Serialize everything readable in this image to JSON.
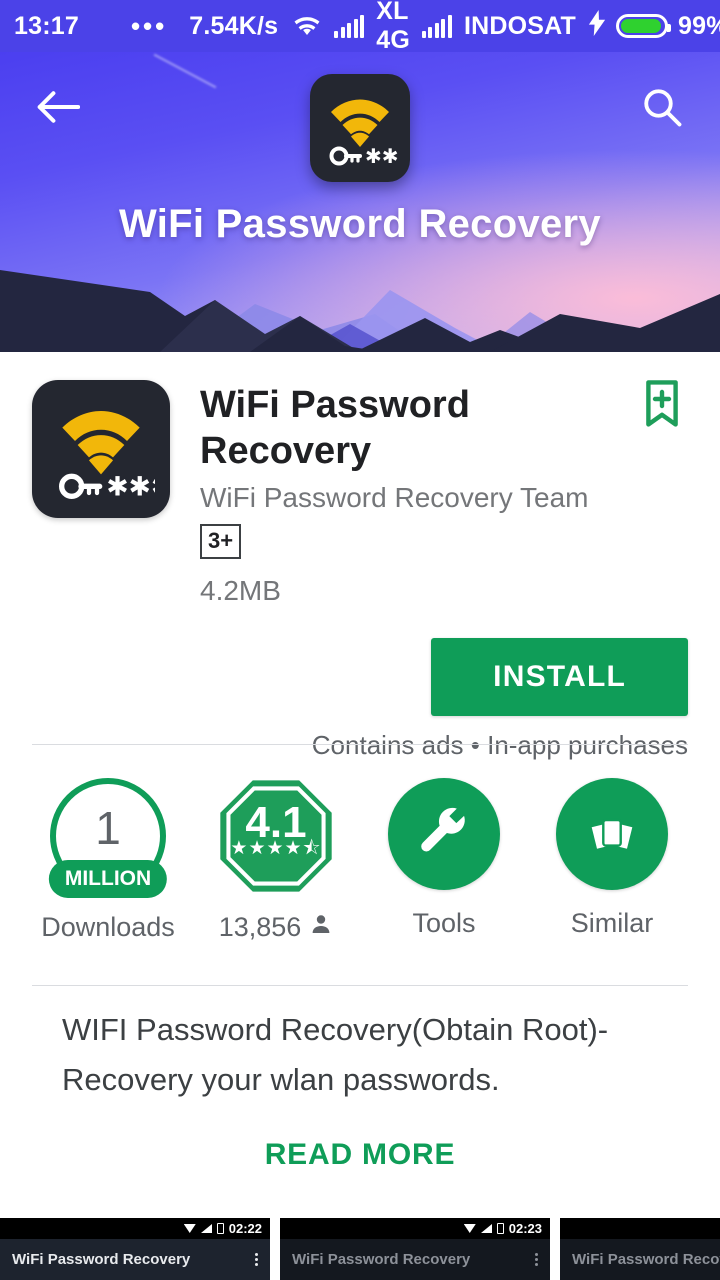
{
  "status_bar": {
    "time": "13:17",
    "dots": "•••",
    "network_speed": "7.54K/s",
    "carrier_1": "XL 4G",
    "carrier_2": "INDOSAT",
    "battery_percent": "99%",
    "icons": [
      "wifi-icon",
      "signal-bars-icon",
      "signal-bars-icon",
      "charging-bolt-icon",
      "battery-icon"
    ],
    "background_color": "#4b42e8"
  },
  "banner": {
    "title": "WiFi Password Recovery",
    "back_icon": "back-arrow-icon",
    "search_icon": "search-icon",
    "app_icon": "wifi-key-app-icon",
    "sky_gradient_top": "#4b3ff0",
    "sky_gradient_bottom": "#cbb8ec",
    "mountain_color": "#232640"
  },
  "app": {
    "title": "WiFi Password Recovery",
    "developer": "WiFi Password Recovery Team",
    "age_rating": "3+",
    "size": "4.2MB",
    "wishlist_icon": "bookmark-add-icon",
    "icon": "wifi-key-app-icon"
  },
  "install": {
    "label": "INSTALL",
    "note": "Contains ads • In-app purchases",
    "button_color": "#0f9d58"
  },
  "stats": [
    {
      "type": "downloads",
      "value": "1",
      "unit": "MILLION",
      "label": "Downloads",
      "icon": "downloads-circle-icon"
    },
    {
      "type": "rating",
      "value": "4.1",
      "stars": "★★★★⯪",
      "label": "13,856",
      "icon": "rating-octagon-icon",
      "label_icon": "person-icon"
    },
    {
      "type": "category",
      "label": "Tools",
      "icon": "wrench-icon"
    },
    {
      "type": "similar",
      "label": "Similar",
      "icon": "cards-fan-icon"
    }
  ],
  "description": {
    "text": "WIFI Password Recovery(Obtain Root)-Recovery your wlan passwords.",
    "read_more": "READ MORE"
  },
  "screenshots": [
    {
      "title": "WiFi Password Recovery",
      "time": "02:22",
      "menu_icon": "kebab-menu-icon"
    },
    {
      "title": "WiFi Password Recovery",
      "time": "02:23",
      "menu_icon": "kebab-menu-icon"
    },
    {
      "title": "WiFi Password Recovery",
      "time": "",
      "menu_icon": "kebab-menu-icon"
    }
  ],
  "colors": {
    "accent_green": "#0f9d58",
    "banner_purple": "#4b3ff0",
    "text_primary": "#202124",
    "text_secondary": "#5f6368"
  }
}
